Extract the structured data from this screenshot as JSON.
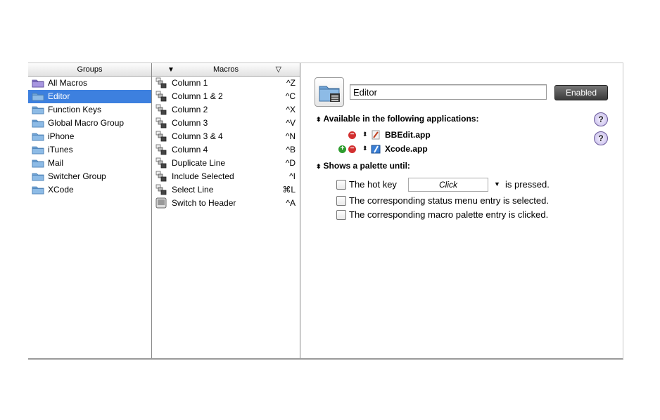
{
  "groups": {
    "header": "Groups",
    "items": [
      {
        "label": "All Macros",
        "icon": "all-macros-folder-icon"
      },
      {
        "label": "Editor",
        "icon": "folder-icon"
      },
      {
        "label": "Function Keys",
        "icon": "folder-icon"
      },
      {
        "label": "Global Macro Group",
        "icon": "folder-icon"
      },
      {
        "label": "iPhone",
        "icon": "folder-icon"
      },
      {
        "label": "iTunes",
        "icon": "folder-icon"
      },
      {
        "label": "Mail",
        "icon": "folder-icon"
      },
      {
        "label": "Switcher Group",
        "icon": "folder-icon"
      },
      {
        "label": "XCode",
        "icon": "folder-icon"
      }
    ],
    "selected_index": 1
  },
  "macros": {
    "header": "Macros",
    "sort_left": "▼",
    "sort_right": "▽",
    "items": [
      {
        "label": "Column 1",
        "key": "^Z"
      },
      {
        "label": "Column 1 & 2",
        "key": "^C"
      },
      {
        "label": "Column 2",
        "key": "^X"
      },
      {
        "label": "Column 3",
        "key": "^V"
      },
      {
        "label": "Column 3 & 4",
        "key": "^N"
      },
      {
        "label": "Column 4",
        "key": "^B"
      },
      {
        "label": "Duplicate Line",
        "key": "^D"
      },
      {
        "label": "Include Selected",
        "key": "^I"
      },
      {
        "label": "Select Line",
        "key": "⌘L"
      },
      {
        "label": "Switch to Header",
        "key": "^A"
      }
    ]
  },
  "detail": {
    "name_value": "Editor",
    "enabled_label": "Enabled",
    "apps_heading": "Available in the following applications:",
    "apps": [
      {
        "label": "BBEdit.app",
        "icon": "bbedit-app-icon"
      },
      {
        "label": "Xcode.app",
        "icon": "xcode-app-icon"
      }
    ],
    "palette_heading": "Shows a palette until:",
    "hotkey_label": "The hot key",
    "hotkey_value": "Click",
    "hotkey_suffix": "is pressed.",
    "status_menu_label": "The corresponding status menu entry is selected.",
    "palette_entry_label": "The corresponding macro palette entry is clicked.",
    "help_glyph": "?",
    "updown_glyph": "⬍",
    "minus_glyph": "−",
    "plus_glyph": "+",
    "dropdown_glyph": "▼"
  },
  "colors": {
    "selection": "#3d80df",
    "folder": "#7fb0de",
    "enabled_button": "#4a4a4a"
  }
}
